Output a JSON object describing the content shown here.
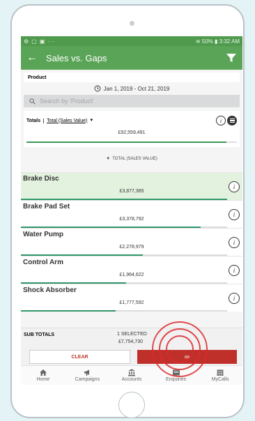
{
  "status_bar": {
    "time": "3:32 AM",
    "battery": "50%"
  },
  "app_bar": {
    "title": "Sales vs. Gaps",
    "back_icon": "arrow-left-icon",
    "filter_icon": "filter-icon"
  },
  "group_by": {
    "label": "Product"
  },
  "date_range": {
    "text": "Jan 1, 2019 - Oct 21, 2019"
  },
  "search": {
    "placeholder": "Search by 'Product'"
  },
  "totals": {
    "label": "Totals",
    "measure": "Total (Sales Value)",
    "value": "£92,559,491",
    "bar_fraction": 0.95
  },
  "sort": {
    "label": "TOTAL (SALES VALUE)"
  },
  "rows": [
    {
      "name": "Brake Disc",
      "value": "£3,877,365",
      "bar_fraction": 1.0,
      "selected": true
    },
    {
      "name": "Brake Pad Set",
      "value": "£3,378,792",
      "bar_fraction": 0.87,
      "selected": false
    },
    {
      "name": "Water Pump",
      "value": "£2,278,979",
      "bar_fraction": 0.59,
      "selected": false
    },
    {
      "name": "Control Arm",
      "value": "£1,964,622",
      "bar_fraction": 0.51,
      "selected": false
    },
    {
      "name": "Shock Absorber",
      "value": "£1,777,592",
      "bar_fraction": 0.46,
      "selected": false
    }
  ],
  "subtotals": {
    "label": "SUB TOTALS",
    "selected": "1 SELECTED",
    "amount": "£7,754,730"
  },
  "actions": {
    "clear": "CLEAR",
    "drill_icon": "link-icon"
  },
  "tabs": [
    {
      "label": "Home",
      "icon": "home-icon"
    },
    {
      "label": "Campaigns",
      "icon": "megaphone-icon"
    },
    {
      "label": "Accounts",
      "icon": "bank-icon"
    },
    {
      "label": "Enquiries",
      "icon": "inbox-icon"
    },
    {
      "label": "MyCalls",
      "icon": "calendar-icon"
    }
  ],
  "colors": {
    "app_bar": "#5aa457",
    "accent_bar": "#2f9669",
    "action_red": "#c0302b",
    "selected_row": "#e3f1df"
  }
}
